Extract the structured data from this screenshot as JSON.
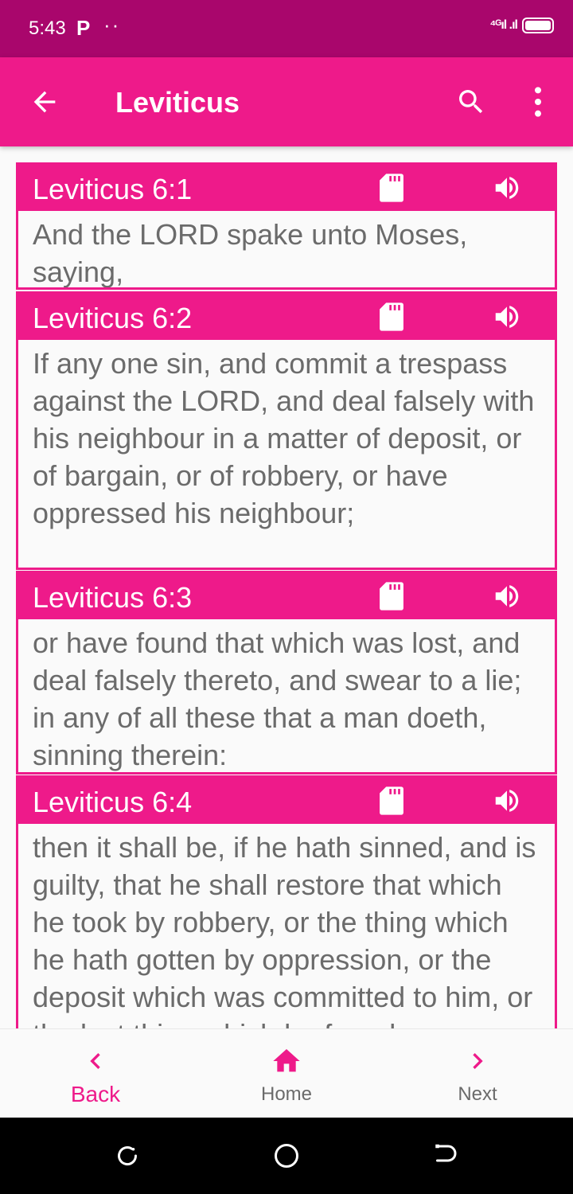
{
  "status_bar": {
    "time": "5:43",
    "p_icon": "P",
    "dots": "··",
    "signal": "⁴ᴳıl .ıl"
  },
  "app_bar": {
    "title": "Leviticus",
    "back_icon": "back-arrow-icon",
    "search_icon": "search-icon",
    "more_icon": "more-vert-icon"
  },
  "verses": [
    {
      "ref": "Leviticus 6:1",
      "text": "And the LORD spake unto Moses, saying,"
    },
    {
      "ref": "Leviticus 6:2",
      "text": "If any one sin, and commit a trespass against the LORD, and deal falsely with his neighbour in a matter of deposit, or of bargain, or of robbery, or have oppressed his neighbour;"
    },
    {
      "ref": "Leviticus 6:3",
      "text": "or have found that which was lost, and deal falsely thereto, and swear to a lie; in any of all these that a man doeth, sinning therein:"
    },
    {
      "ref": "Leviticus 6:4",
      "text": "then it shall be, if he hath sinned, and is guilty, that he shall restore that which he took by robbery, or the thing which he hath gotten by oppression, or the deposit which was committed to him, or the lost thing which he found,"
    }
  ],
  "bottom_nav": {
    "back_label": "Back",
    "home_label": "Home",
    "next_label": "Next"
  },
  "colors": {
    "primary": "#ee1a8a",
    "status": "#a9066c",
    "text": "#6b6b6b"
  }
}
